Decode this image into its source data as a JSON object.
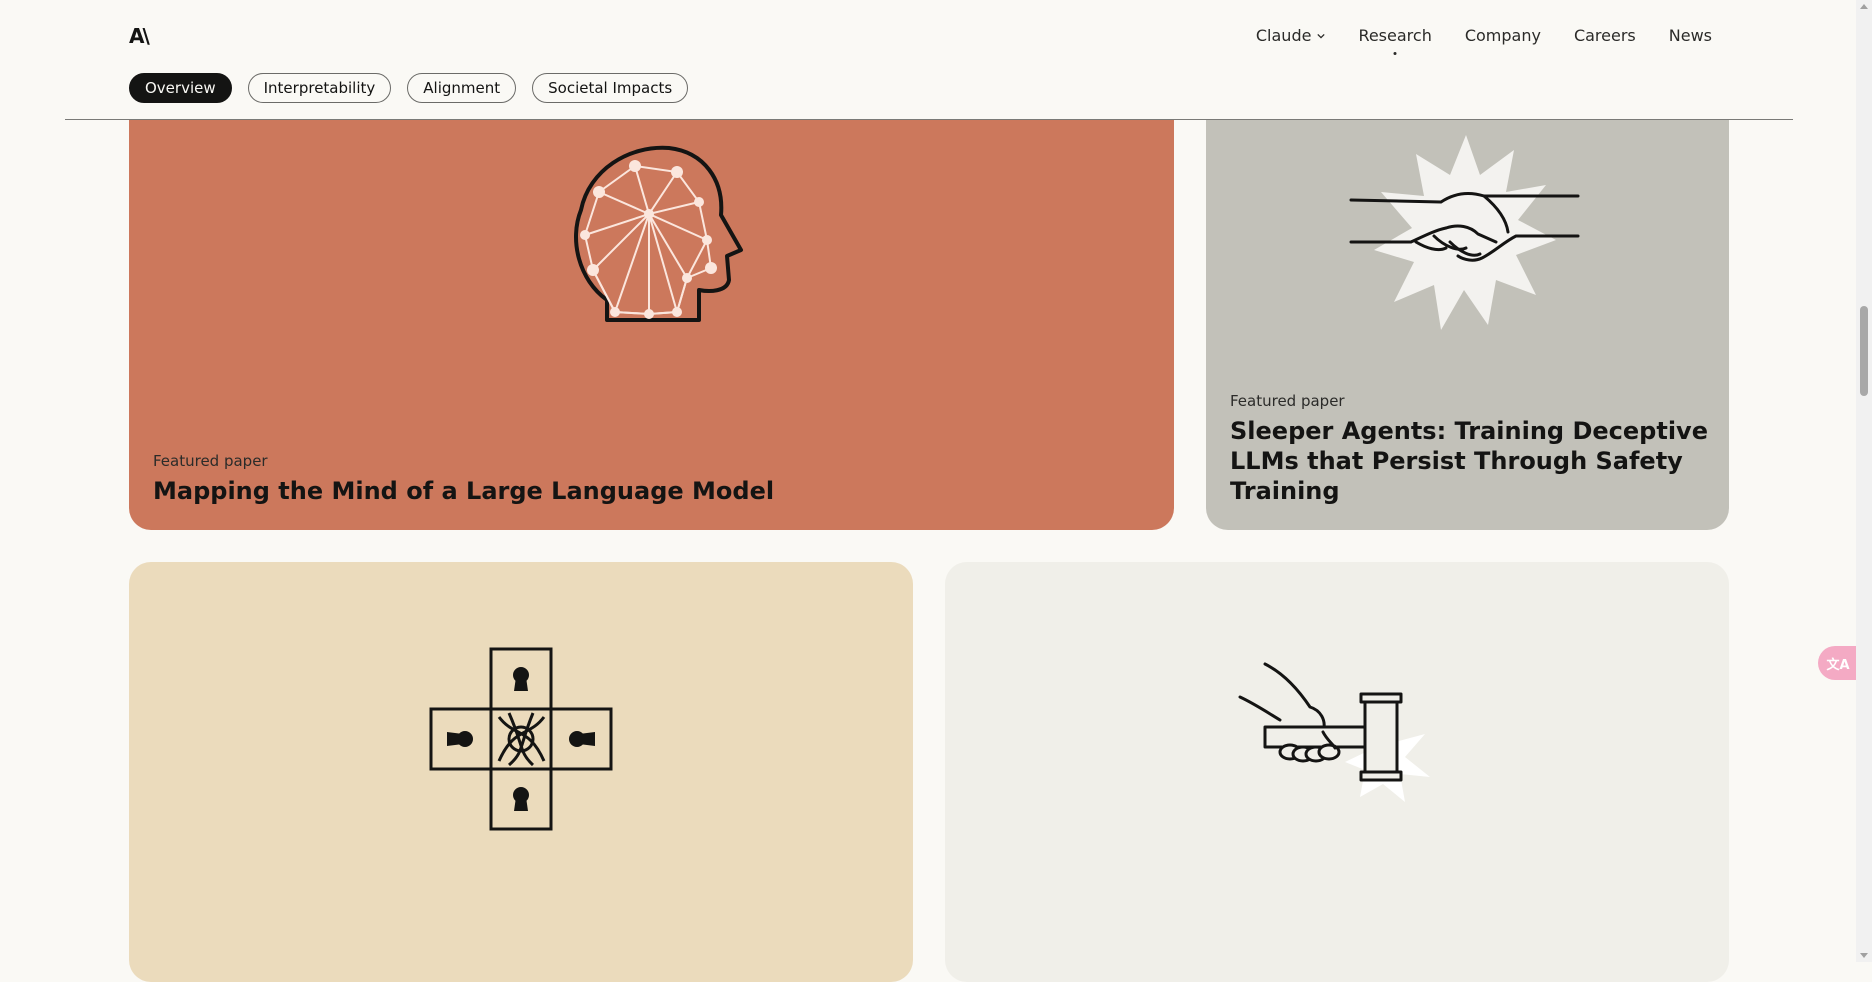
{
  "brand": {
    "logo_text": "A\\"
  },
  "nav": {
    "items": [
      {
        "label": "Claude",
        "has_dropdown": true
      },
      {
        "label": "Research",
        "active": true
      },
      {
        "label": "Company"
      },
      {
        "label": "Careers"
      },
      {
        "label": "News"
      }
    ]
  },
  "tabs": [
    {
      "label": "Overview",
      "active": true
    },
    {
      "label": "Interpretability"
    },
    {
      "label": "Alignment"
    },
    {
      "label": "Societal Impacts"
    }
  ],
  "cards": [
    {
      "label": "Featured paper",
      "title": "Mapping the Mind of a Large Language Model",
      "color": "#cc785c",
      "icon": "head-network-icon"
    },
    {
      "label": "Featured paper",
      "title_lines": [
        "Sleeper Agents: Training Deceptive",
        "LLMs that Persist Through Safety",
        "Training"
      ],
      "color": "#c2c1b9",
      "icon": "handshake-icon"
    },
    {
      "color": "#ebdbbc",
      "icon": "keyhole-cross-icon"
    },
    {
      "color": "#f0efe9",
      "icon": "gavel-hand-icon"
    }
  ],
  "translate_widget": {
    "label": "文A"
  }
}
